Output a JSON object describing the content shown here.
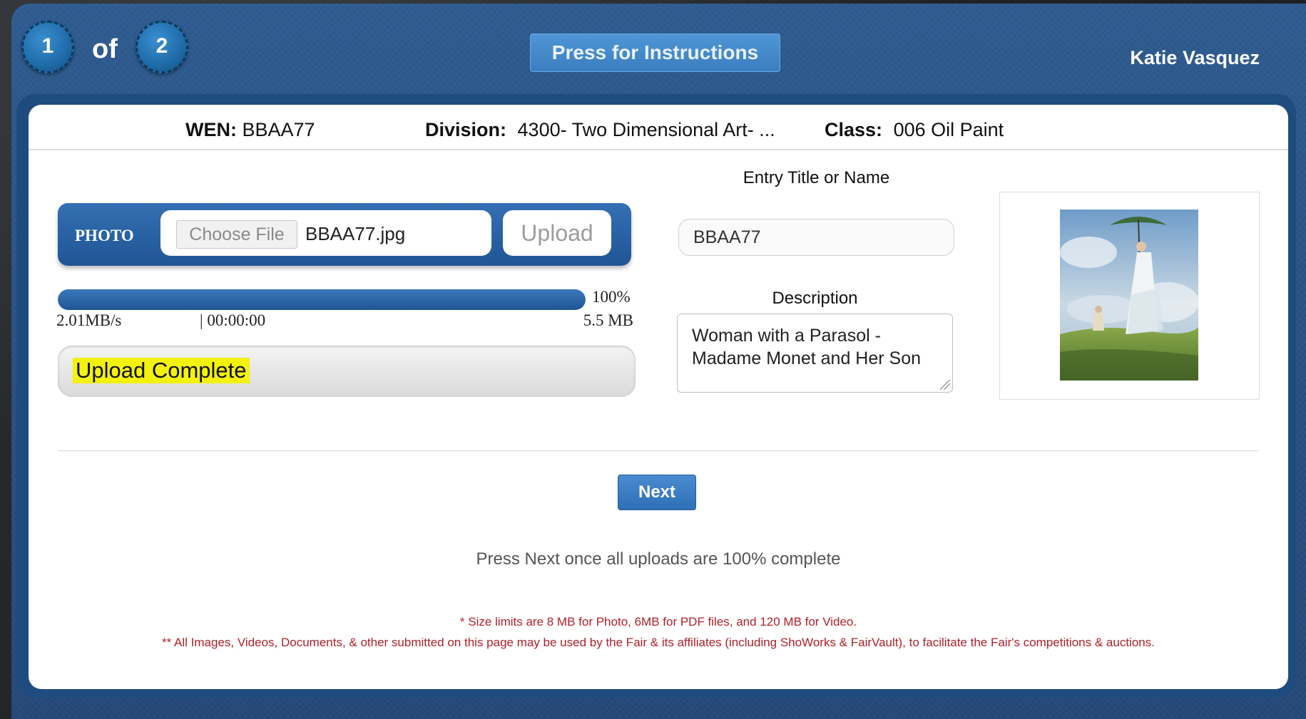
{
  "header": {
    "step_current": "1",
    "step_of": "of",
    "step_total": "2",
    "instructions_label": "Press for Instructions",
    "user_name": "Katie Vasquez"
  },
  "info": {
    "wen_label": "WEN:",
    "wen_value": "BBAA77",
    "division_label": "Division:",
    "division_value": "4300- Two Dimensional Art- ...",
    "class_label": "Class:",
    "class_value": "006 Oil Paint"
  },
  "upload": {
    "photo_label": "PHOTO",
    "choose_file_label": "Choose File",
    "file_name": "BBAA77.jpg",
    "upload_label": "Upload",
    "progress_percent": 100,
    "progress_text": "100%",
    "speed": "2.01MB/s",
    "elapsed": "| 00:00:00",
    "size": "5.5 MB",
    "status": "Upload Complete"
  },
  "form": {
    "title_label": "Entry Title or Name",
    "title_value": "BBAA77",
    "description_label": "Description",
    "description_value": "Woman with a Parasol - Madame Monet and Her Son"
  },
  "actions": {
    "next_label": "Next",
    "hint": "Press Next once all uploads are 100% complete"
  },
  "notes": {
    "size_limits": "* Size limits are 8 MB for Photo, 6MB for PDF files, and 120 MB for Video.",
    "usage": "** All Images, Videos, Documents, & other submitted on this page may be used by the Fair & its affiliates (including ShoWorks & FairVault), to facilitate the Fair's competitions & auctions."
  },
  "colors": {
    "header_blue": "#2f5c91",
    "button_blue": "#3b7ec0",
    "highlight_yellow": "#f3f20e",
    "note_red": "#b0202a"
  }
}
